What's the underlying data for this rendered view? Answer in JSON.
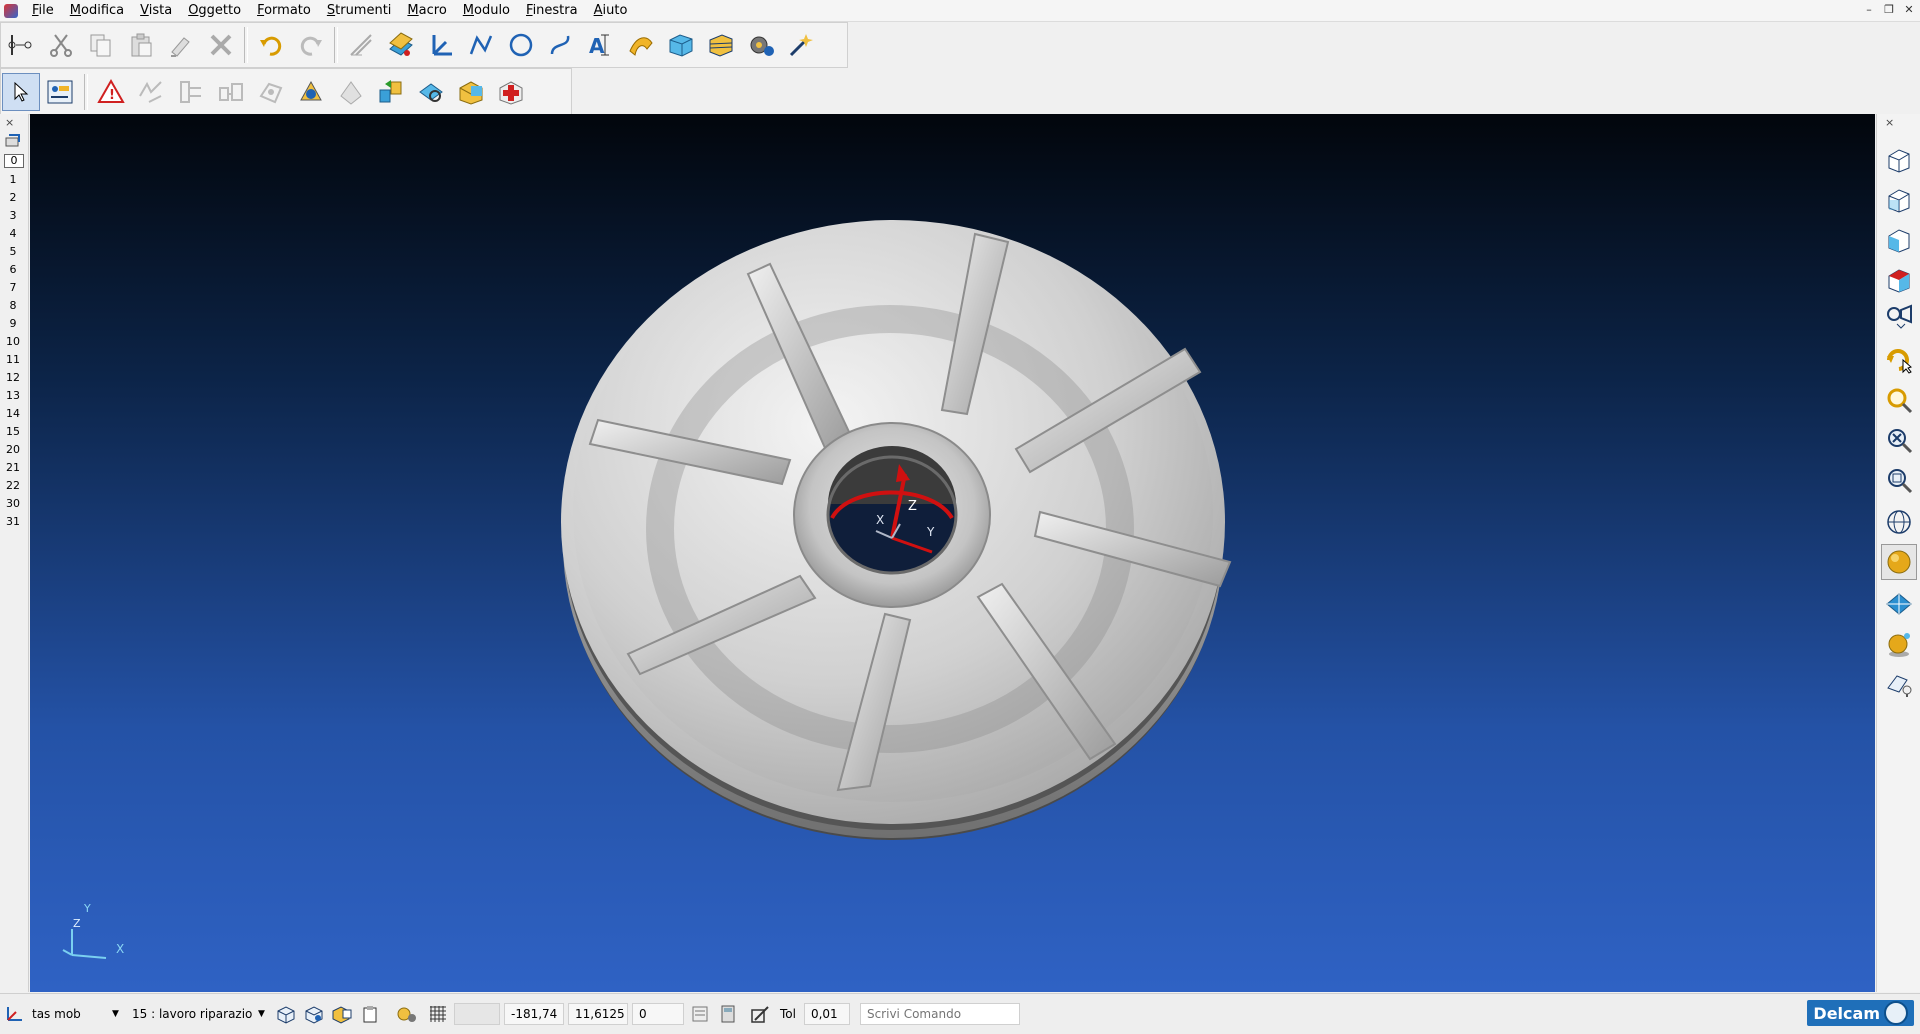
{
  "menubar": {
    "items": [
      "File",
      "Modifica",
      "Vista",
      "Oggetto",
      "Formato",
      "Strumenti",
      "Macro",
      "Modulo",
      "Finestra",
      "Aiuto"
    ]
  },
  "toolbar_main": {
    "icons": [
      "cut-icon",
      "copy-icon",
      "paste-icon",
      "paint-format-icon",
      "delete-icon",
      "undo-icon",
      "redo-icon",
      "edit-icon",
      "layers-icon",
      "workplane-icon",
      "line-icon",
      "circle-icon",
      "curve-icon",
      "text-icon",
      "surface-icon",
      "solid-icon",
      "mesh-icon",
      "machining-icon",
      "wizard-icon"
    ]
  },
  "toolbar_secondary": {
    "icons": [
      "select-arrow-icon",
      "selection-filter-icon",
      "warning-icon",
      "trim-icon",
      "edit-curve-icon",
      "offset-icon",
      "transform-icon",
      "rotate-icon",
      "drill-icon",
      "assembly-icon",
      "analysis-icon",
      "cut-view-icon",
      "heal-icon"
    ]
  },
  "levels": {
    "tab_close": "×",
    "items": [
      "0",
      "1",
      "2",
      "3",
      "4",
      "5",
      "6",
      "7",
      "8",
      "9",
      "10",
      "11",
      "12",
      "13",
      "14",
      "15",
      "20",
      "21",
      "22",
      "30",
      "31"
    ]
  },
  "viewport": {
    "triad_labels": {
      "z": "Z",
      "y": "Y",
      "x": "X"
    },
    "axes_small": {
      "y": "Y",
      "z": "Z",
      "x": "X"
    }
  },
  "rightbar": {
    "close": "×",
    "icons": [
      "view-iso1-icon",
      "view-iso2-icon",
      "view-front-icon",
      "view-top-icon",
      "view-camera-icon",
      "rotate-view-icon",
      "zoom-rotate-icon",
      "zoom-fit-icon",
      "zoom-box-icon",
      "wireframe-icon",
      "shaded-icon",
      "plane-icon",
      "material-icon",
      "light-icon"
    ]
  },
  "statusbar": {
    "workplane": "tas mob",
    "level": "15 : lavoro riparazio",
    "coord_x": "-181,74",
    "coord_y": "11,6125",
    "coord_z": "0",
    "tol_label": "Tol",
    "tol_value": "0,01",
    "command_placeholder": "Scrivi Comando",
    "brand": "Delcam"
  },
  "colors": {
    "viewport_top": "#02060c",
    "viewport_bottom": "#2f62c4",
    "axis_red": "#d01010",
    "part_grey": "#c8c8c8"
  }
}
